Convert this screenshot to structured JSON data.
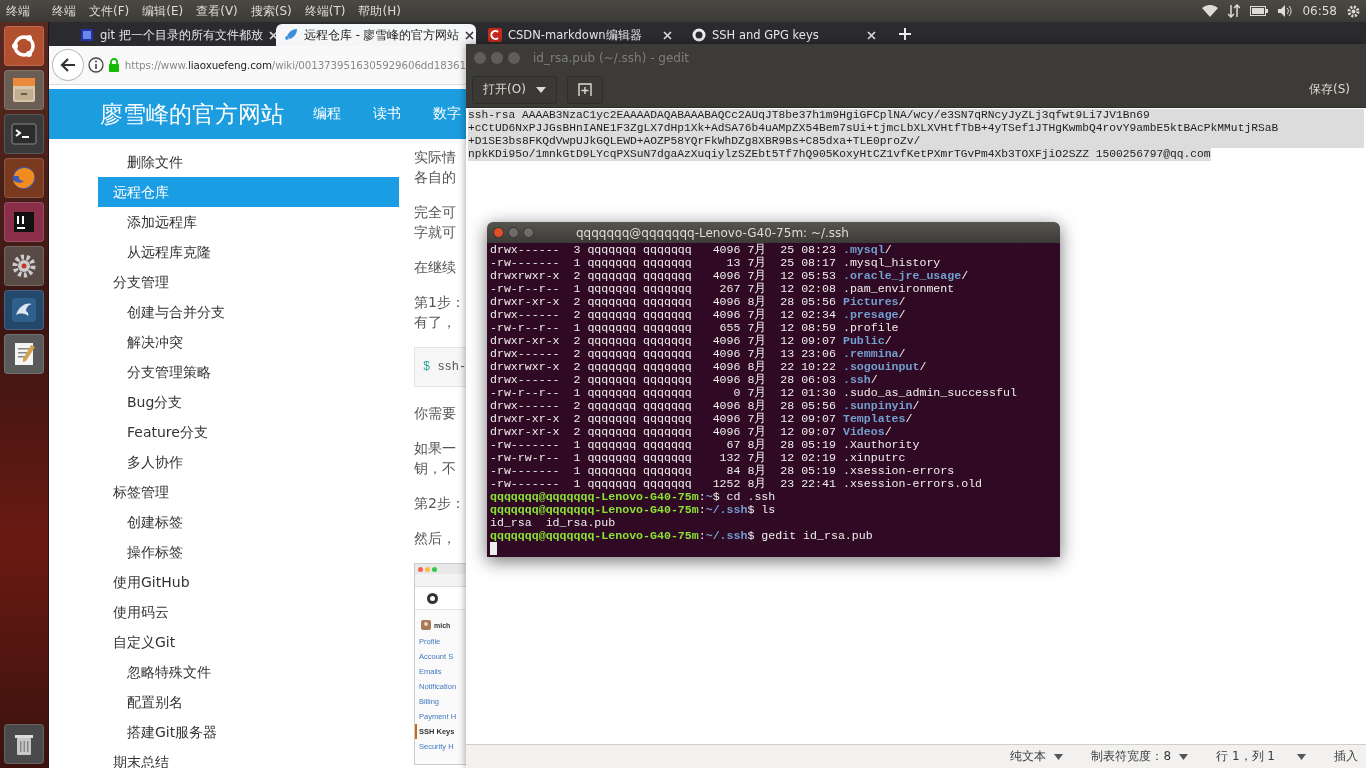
{
  "top_panel": {
    "app_name": "终端",
    "menus": [
      "终端",
      "文件(F)",
      "编辑(E)",
      "查看(V)",
      "搜索(S)",
      "终端(T)",
      "帮助(H)"
    ],
    "clock": "06:58"
  },
  "launcher": {
    "items": [
      {
        "kind": "ubuntu"
      },
      {
        "kind": "files"
      },
      {
        "kind": "terminal"
      },
      {
        "kind": "firefox"
      },
      {
        "kind": "intellij"
      },
      {
        "kind": "settings"
      },
      {
        "kind": "workbench"
      },
      {
        "kind": "editor"
      },
      {
        "kind": "trash"
      }
    ]
  },
  "browser": {
    "tabs": [
      {
        "title": "git 把一个目录的所有文件都放",
        "selected": false
      },
      {
        "title": "远程仓库 - 廖雪峰的官方网站",
        "selected": true
      },
      {
        "title": "CSDN-markdown编辑器",
        "selected": false
      },
      {
        "title": "SSH and GPG keys",
        "selected": false
      }
    ],
    "url": {
      "scheme": "https://www.",
      "domain": "liaoxuefeng.com",
      "path": "/wiki/0013739516305929606dd18361"
    },
    "site_title": "廖雪峰的官方网站",
    "site_nav": [
      "编程",
      "读书",
      "数字"
    ],
    "sidebar": {
      "items": [
        {
          "children": [
            {
              "label": "删除文件",
              "selected": false
            }
          ]
        },
        {
          "label": "远程仓库",
          "selected": true,
          "children": [
            {
              "label": "添加远程库",
              "selected": false
            },
            {
              "label": "从远程库克隆",
              "selected": false
            }
          ]
        },
        {
          "label": "分支管理",
          "selected": false,
          "children": [
            {
              "label": "创建与合并分支",
              "selected": false
            },
            {
              "label": "解决冲突",
              "selected": false
            },
            {
              "label": "分支管理策略",
              "selected": false
            },
            {
              "label": "Bug分支",
              "selected": false
            },
            {
              "label": "Feature分支",
              "selected": false
            },
            {
              "label": "多人协作",
              "selected": false
            }
          ]
        },
        {
          "label": "标签管理",
          "selected": false,
          "children": [
            {
              "label": "创建标签",
              "selected": false
            },
            {
              "label": "操作标签",
              "selected": false
            }
          ]
        },
        {
          "label": "使用GitHub",
          "selected": false
        },
        {
          "label": "使用码云",
          "selected": false
        },
        {
          "label": "自定义Git",
          "selected": false,
          "children": [
            {
              "label": "忽略特殊文件",
              "selected": false
            },
            {
              "label": "配置别名",
              "selected": false
            },
            {
              "label": "搭建Git服务器",
              "selected": false
            }
          ]
        },
        {
          "label": "期末总结",
          "selected": false
        }
      ]
    },
    "article": [
      {
        "kind": "para",
        "lines": [
          "实际情",
          "各自的"
        ]
      },
      {
        "kind": "para",
        "lines": [
          "完全可",
          "字就可"
        ]
      },
      {
        "kind": "para",
        "lines": [
          "在继续"
        ]
      },
      {
        "kind": "para",
        "lines": [
          "第1步：",
          "有了，"
        ]
      },
      {
        "kind": "code",
        "prompt": "$",
        "text": "ssh-"
      },
      {
        "kind": "para",
        "lines": [
          "你需要"
        ]
      },
      {
        "kind": "para",
        "lines": [
          "如果一",
          "钥，不"
        ]
      },
      {
        "kind": "para",
        "lines": [
          "第2步："
        ]
      },
      {
        "kind": "para",
        "lines": [
          "然后，"
        ]
      },
      {
        "kind": "screenshot",
        "user": "mich",
        "menu": [
          {
            "label": "Profile",
            "selected": false
          },
          {
            "label": "Account S",
            "selected": false
          },
          {
            "label": "Emails",
            "selected": false
          },
          {
            "label": "Notification",
            "selected": false
          },
          {
            "label": "Billing",
            "selected": false
          },
          {
            "label": "Payment H",
            "selected": false
          },
          {
            "label": "SSH Keys",
            "selected": true
          },
          {
            "label": "Security H",
            "selected": false
          }
        ]
      }
    ]
  },
  "gedit": {
    "title": "id_rsa.pub (~/.ssh) - gedit",
    "open_button": "打开(O)",
    "save_button": "保存(S)",
    "text": {
      "selected": true,
      "lines": [
        "ssh-rsa AAAAB3NzaC1yc2EAAAADAQABAAABAQCc2AUqJT8be37h1m9HgiGFCplNA/wcy/e3SN7qRNcyJyZLj3qfwt9Li7JV1Bn69",
        "+cCtUD6NxPJJGsBHnIANE1F3ZgLX7dHp1Xk+AdSA76b4uAMpZX54Bem7sUi+tjmcLbXLXVHtfTbB+4yTSef1JTHgKwmbQ4rovY9ambE5ktBAcPkMMutjRSaB",
        "+D1SE3bs8FKQdVwpUJkGQLEWD+AOZP58YQrFkWhDZg8XBR9Bs+C85dxa+TLE0proZv/",
        "npkKDi95o/1mnkGtD9LYcqPXSuN7dgaAzXuqiylzSZEbt5Tf7hQ905KoxyHtCZ1vfKetPXmrTGvPm4Xb3TOXFjiO2SZZ 1500256797@qq.com"
      ]
    },
    "status": {
      "language": "纯文本",
      "tab_width": "制表符宽度：8",
      "position": "行 1，列 1",
      "mode": "插入"
    }
  },
  "terminal": {
    "title": "qqqqqqq@qqqqqqq-Lenovo-G40-75m: ~/.ssh",
    "lines": [
      {
        "kind": "entry",
        "info": "drwx------  3 qqqqqqq qqqqqqq   4096 7月  25 08:23 ",
        "name": ".mysql",
        "dir": true,
        "suffix": "/"
      },
      {
        "kind": "entry",
        "info": "-rw-------  1 qqqqqqq qqqqqqq     13 7月  25 08:17 ",
        "name": ".mysql_history",
        "dir": false
      },
      {
        "kind": "entry",
        "info": "drwxrwxr-x  2 qqqqqqq qqqqqqq   4096 7月  12 05:53 ",
        "name": ".oracle_jre_usage",
        "dir": true,
        "suffix": "/"
      },
      {
        "kind": "entry",
        "info": "-rw-r--r--  1 qqqqqqq qqqqqqq    267 7月  12 02:08 ",
        "name": ".pam_environment",
        "dir": false
      },
      {
        "kind": "entry",
        "info": "drwxr-xr-x  2 qqqqqqq qqqqqqq   4096 8月  28 05:56 ",
        "name": "Pictures",
        "dir": true,
        "suffix": "/"
      },
      {
        "kind": "entry",
        "info": "drwx------  2 qqqqqqq qqqqqqq   4096 7月  12 02:34 ",
        "name": ".presage",
        "dir": true,
        "suffix": "/"
      },
      {
        "kind": "entry",
        "info": "-rw-r--r--  1 qqqqqqq qqqqqqq    655 7月  12 08:59 ",
        "name": ".profile",
        "dir": false
      },
      {
        "kind": "entry",
        "info": "drwxr-xr-x  2 qqqqqqq qqqqqqq   4096 7月  12 09:07 ",
        "name": "Public",
        "dir": true,
        "suffix": "/"
      },
      {
        "kind": "entry",
        "info": "drwx------  2 qqqqqqq qqqqqqq   4096 7月  13 23:06 ",
        "name": ".remmina",
        "dir": true,
        "suffix": "/"
      },
      {
        "kind": "entry",
        "info": "drwxrwxr-x  2 qqqqqqq qqqqqqq   4096 8月  22 10:22 ",
        "name": ".sogouinput",
        "dir": true,
        "suffix": "/"
      },
      {
        "kind": "entry",
        "info": "drwx------  2 qqqqqqq qqqqqqq   4096 8月  28 06:03 ",
        "name": ".ssh",
        "dir": true,
        "suffix": "/"
      },
      {
        "kind": "entry",
        "info": "-rw-r--r--  1 qqqqqqq qqqqqqq      0 7月  12 01:30 ",
        "name": ".sudo_as_admin_successful",
        "dir": false
      },
      {
        "kind": "entry",
        "info": "drwx------  2 qqqqqqq qqqqqqq   4096 8月  28 05:56 ",
        "name": ".sunpinyin",
        "dir": true,
        "suffix": "/"
      },
      {
        "kind": "entry",
        "info": "drwxr-xr-x  2 qqqqqqq qqqqqqq   4096 7月  12 09:07 ",
        "name": "Templates",
        "dir": true,
        "suffix": "/"
      },
      {
        "kind": "entry",
        "info": "drwxr-xr-x  2 qqqqqqq qqqqqqq   4096 7月  12 09:07 ",
        "name": "Videos",
        "dir": true,
        "suffix": "/"
      },
      {
        "kind": "entry",
        "info": "-rw-------  1 qqqqqqq qqqqqqq     67 8月  28 05:19 ",
        "name": ".Xauthority",
        "dir": false
      },
      {
        "kind": "entry",
        "info": "-rw-rw-r--  1 qqqqqqq qqqqqqq    132 7月  12 02:19 ",
        "name": ".xinputrc",
        "dir": false
      },
      {
        "kind": "entry",
        "info": "-rw-------  1 qqqqqqq qqqqqqq     84 8月  28 05:19 ",
        "name": ".xsession-errors",
        "dir": false
      },
      {
        "kind": "entry",
        "info": "-rw-------  1 qqqqqqq qqqqqqq   1252 8月  23 22:41 ",
        "name": ".xsession-errors.old",
        "dir": false
      },
      {
        "kind": "prompt",
        "host": "qqqqqqq@qqqqqqq-Lenovo-G40-75m",
        "sep": ":",
        "path": "~",
        "command": "$ cd .ssh"
      },
      {
        "kind": "prompt",
        "host": "qqqqqqq@qqqqqqq-Lenovo-G40-75m",
        "sep": ":",
        "path": "~/.ssh",
        "command": "$ ls"
      },
      {
        "kind": "output",
        "text": "id_rsa  id_rsa.pub"
      },
      {
        "kind": "prompt",
        "host": "qqqqqqq@qqqqqqq-Lenovo-G40-75m",
        "sep": ":",
        "path": "~/.ssh",
        "command": "$ gedit id_rsa.pub"
      },
      {
        "kind": "cursor"
      }
    ]
  }
}
